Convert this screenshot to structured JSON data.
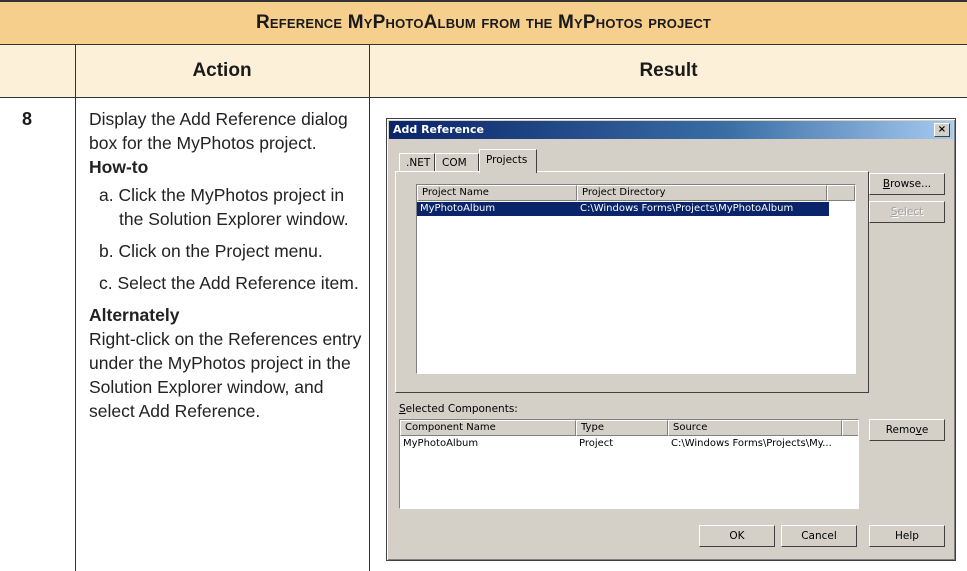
{
  "table": {
    "title": "Reference MyPhotoAlbum from the MyPhotos project",
    "col_action": "Action",
    "col_result": "Result",
    "step_number": "8",
    "action_text": "Display the Add Reference dialog box for the MyPhotos project.",
    "howto_title": "How-to",
    "howto_steps": [
      "a. Click the MyPhotos project in the Solution Explorer window.",
      "b. Click on the Project menu.",
      "c. Select the Add Reference item."
    ],
    "alt_title": "Alternately",
    "alt_text": "Right-click on the References entry under the MyPhotos project in the Solution Explorer window, and select Add Reference."
  },
  "dialog": {
    "title": "Add Reference",
    "close_glyph": "×",
    "tabs": [
      ".NET",
      "COM",
      "Projects"
    ],
    "active_tab": "Projects",
    "projects_list": {
      "columns": [
        "Project Name",
        "Project Directory"
      ],
      "rows": [
        {
          "name": "MyPhotoAlbum",
          "directory": "C:\\Windows Forms\\Projects\\MyPhotoAlbum",
          "selected": true
        }
      ]
    },
    "browse_button": {
      "pre": "",
      "accel": "B",
      "post": "rowse..."
    },
    "select_button": {
      "pre": "",
      "accel": "S",
      "post": "elect"
    },
    "selected_label": {
      "pre": "",
      "accel": "S",
      "post": "elected Components:"
    },
    "components_list": {
      "columns": [
        "Component Name",
        "Type",
        "Source"
      ],
      "rows": [
        {
          "name": "MyPhotoAlbum",
          "type": "Project",
          "source": "C:\\Windows Forms\\Projects\\My..."
        }
      ]
    },
    "remove_button": {
      "pre": "Remo",
      "accel": "v",
      "post": "e"
    },
    "ok_button": "OK",
    "cancel_button": "Cancel",
    "help_button": "Help"
  },
  "colors": {
    "title_bar": "#f6cf8c",
    "header_bar": "#fdf0d9",
    "dialog_face": "#d4d0c8",
    "selection": "#0a246a"
  }
}
